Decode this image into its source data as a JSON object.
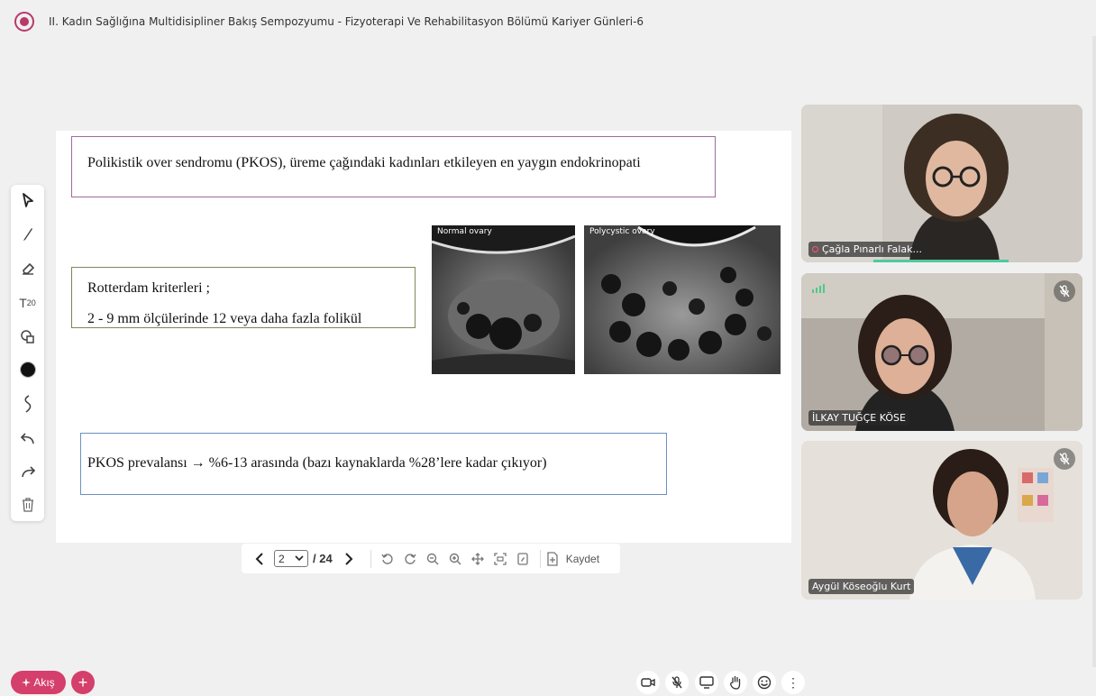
{
  "header": {
    "title": "II. Kadın Sağlığına Multidisipliner Bakış Sempozyumu - Fizyoterapi Ve Rehabilitasyon Bölümü Kariyer Günleri-6",
    "logo_icon": "flower-logo-icon"
  },
  "slide": {
    "box1_text": "Polikistik over sendromu (PKOS), üreme çağındaki kadınları etkileyen en yaygın endokrinopati",
    "box2_line1": "Rotterdam kriterleri ;",
    "box2_line2": "2 - 9 mm ölçülerinde 12 veya daha fazla folikül",
    "box3_text": "PKOS prevalansı → %6-13 arasında (bazı kaynaklarda %28’lere kadar çıkıyor)",
    "image_label_normal": "Normal ovary",
    "image_label_polycystic": "Polycystic ovary"
  },
  "toolbar": {
    "tools": [
      "select-icon",
      "pen-icon",
      "eraser-icon",
      "text-size-icon",
      "shapes-icon",
      "color-icon",
      "curve-icon",
      "undo-icon",
      "redo-icon",
      "trash-icon"
    ],
    "text_size_sub": "20",
    "text_size_letter": "T"
  },
  "pager": {
    "current_page": "2",
    "total_pages": "/ 24",
    "save_label": "Kaydet"
  },
  "participants": [
    {
      "name": "Çağla Pınarlı Falak...",
      "muted": false,
      "recording": true
    },
    {
      "name": "İLKAY TUĞÇE KÖSE",
      "muted": true
    },
    {
      "name": "Aygül Köseoğlu Kurt",
      "muted": true
    }
  ],
  "bottom_bar": {
    "akis_label": "Akış",
    "plus_label": "+",
    "more_label": "⋮"
  },
  "colors": {
    "accent": "#d43f6b",
    "speaking": "#4ec9a0"
  }
}
